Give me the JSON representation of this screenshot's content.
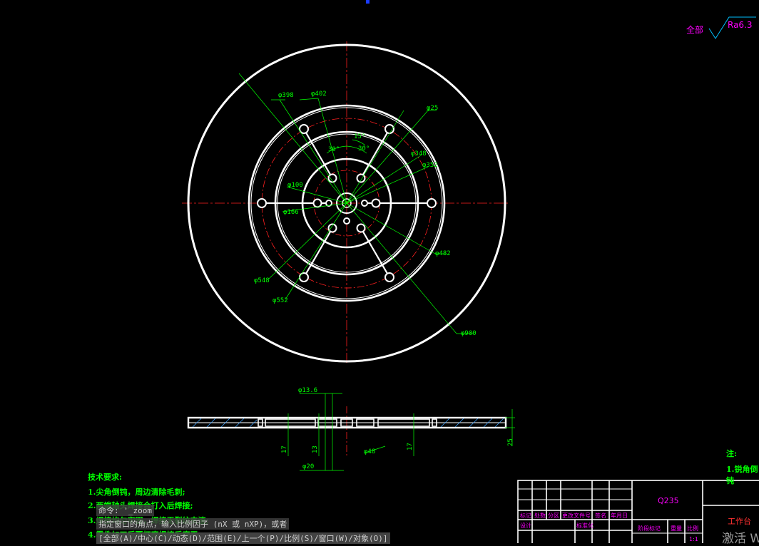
{
  "colors": {
    "background": "#000000",
    "outline": "#ffffff",
    "dimension": "#00ff00",
    "centerline": "#ff2020",
    "annotation": "#ff00ff"
  },
  "roughness": {
    "prefix": "全部",
    "value": "Ra6.3"
  },
  "dimensions": {
    "d398": "φ398",
    "d402": "φ402",
    "d25": "φ25",
    "d348": "φ348",
    "d352": "φ352",
    "d100": "φ100",
    "d166": "φ166",
    "d482": "φ482",
    "d548": "φ548",
    "d552": "φ552",
    "d900": "φ900",
    "a30_left": "30°",
    "a30_right": "30°",
    "a15": "15°",
    "d13_6": "φ13.6",
    "d20": "φ20",
    "d48": "φ48",
    "t17a": "17",
    "t17b": "17",
    "t13": "13",
    "t25": "25"
  },
  "tech_requirements": {
    "title": "技术要求:",
    "item1": "1.尖角倒钝，周边清除毛刺;",
    "item2": "2.两端轴头焊接合打入后焊接;",
    "item3": "3.焊接均匀牢固，焊接无裂纹夹渣;",
    "item4": "4.零件加工后要打磨焊接后磨平"
  },
  "notes": {
    "title": "注:",
    "item1": "1.锐角倒钝"
  },
  "command_line": {
    "line1": "命令: '_zoom",
    "line2": "指定窗口的角点，输入比例因子 (nX 或 nXP)，或者",
    "line3": "[全部(A)/中心(C)/动态(D)/范围(E)/上一个(P)/比例(S)/窗口(W)/对象(O)]"
  },
  "title_block": {
    "material": "Q235",
    "part_name": "工作台",
    "h_mark": "标记",
    "h_count": "处数",
    "h_zone": "分区",
    "h_doc": "更改文件号",
    "h_sign": "签名",
    "h_date": "年月日",
    "design": "设计",
    "standard": "标准化",
    "stage": "阶段标记",
    "weight": "重量",
    "scale": "比例",
    "scale_value": "1:1"
  },
  "watermark": "激活 W"
}
